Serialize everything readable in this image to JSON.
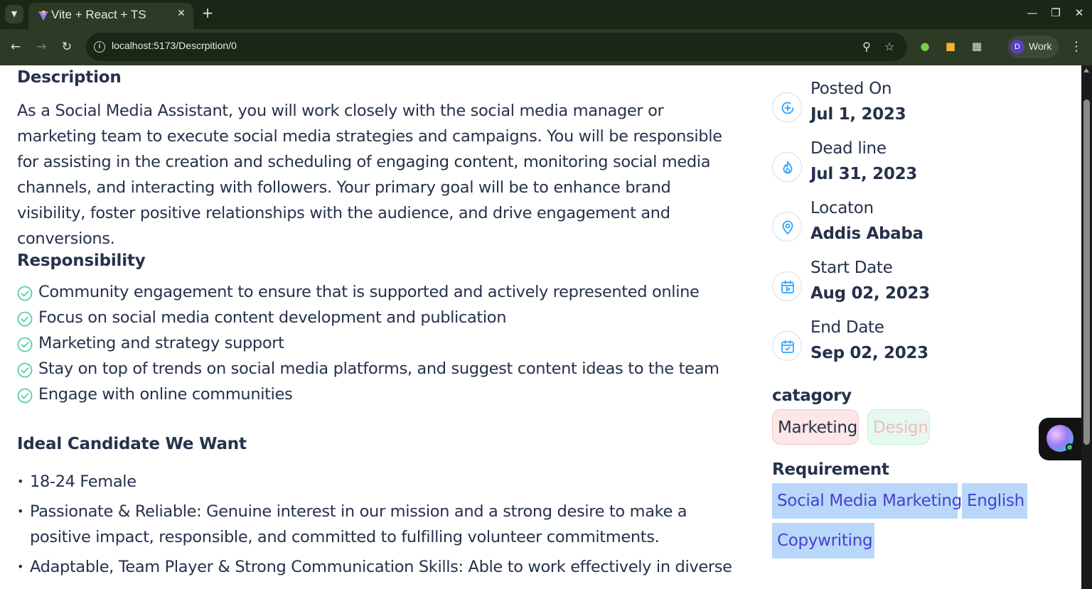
{
  "browser": {
    "tab_title": "Vite + React + TS",
    "url": "localhost:5173/Descrpition/0",
    "profile_initial": "D",
    "profile_name": "Work"
  },
  "description": {
    "heading": "Description",
    "text": "As a Social Media Assistant, you will work closely with the social media manager or marketing team to execute social media strategies and campaigns. You will be responsible for assisting in the creation and scheduling of engaging content, monitoring social media channels, and interacting with followers. Your primary goal will be to enhance brand visibility, foster positive relationships with the audience, and drive engagement and conversions."
  },
  "responsibility": {
    "heading": "Responsibility",
    "items": [
      "Community engagement to ensure that is supported and actively represented online",
      "Focus on social media content development and publication",
      "Marketing and strategy support",
      "Stay on top of trends on social media platforms, and suggest content ideas to the team",
      "Engage with online communities"
    ]
  },
  "ideal": {
    "heading": "Ideal Candidate We Want",
    "items": [
      "18-24 Female",
      "Passionate & Reliable: Genuine interest in our mission and a strong desire to make a positive impact, responsible, and committed to fulfilling volunteer commitments.",
      "Adaptable, Team Player & Strong Communication Skills: Able to work effectively in diverse"
    ]
  },
  "info": {
    "posted_on": {
      "label": "Posted On",
      "value": "Jul 1, 2023",
      "icon": "plus-circle-icon"
    },
    "deadline": {
      "label": "Dead line",
      "value": "Jul 31, 2023",
      "icon": "fire-icon"
    },
    "location": {
      "label": "Locaton",
      "value": "Addis Ababa",
      "icon": "location-pin-icon"
    },
    "start_date": {
      "label": "Start Date",
      "value": "Aug 02, 2023",
      "icon": "calendar-icon"
    },
    "end_date": {
      "label": "End Date",
      "value": "Sep 02, 2023",
      "icon": "calendar-check-icon"
    }
  },
  "category": {
    "heading": "catagory",
    "tags": [
      "Marketing",
      "Design"
    ]
  },
  "requirement": {
    "heading": "Requirement",
    "tags": [
      "Social Media Marketing",
      "English",
      "Copywriting"
    ]
  },
  "colors": {
    "text": "#25324b",
    "accent_blue": "#26a4ff",
    "check_green": "#56cdad",
    "requirement_bg": "#b9d7fb",
    "requirement_text": "#4641d1"
  }
}
